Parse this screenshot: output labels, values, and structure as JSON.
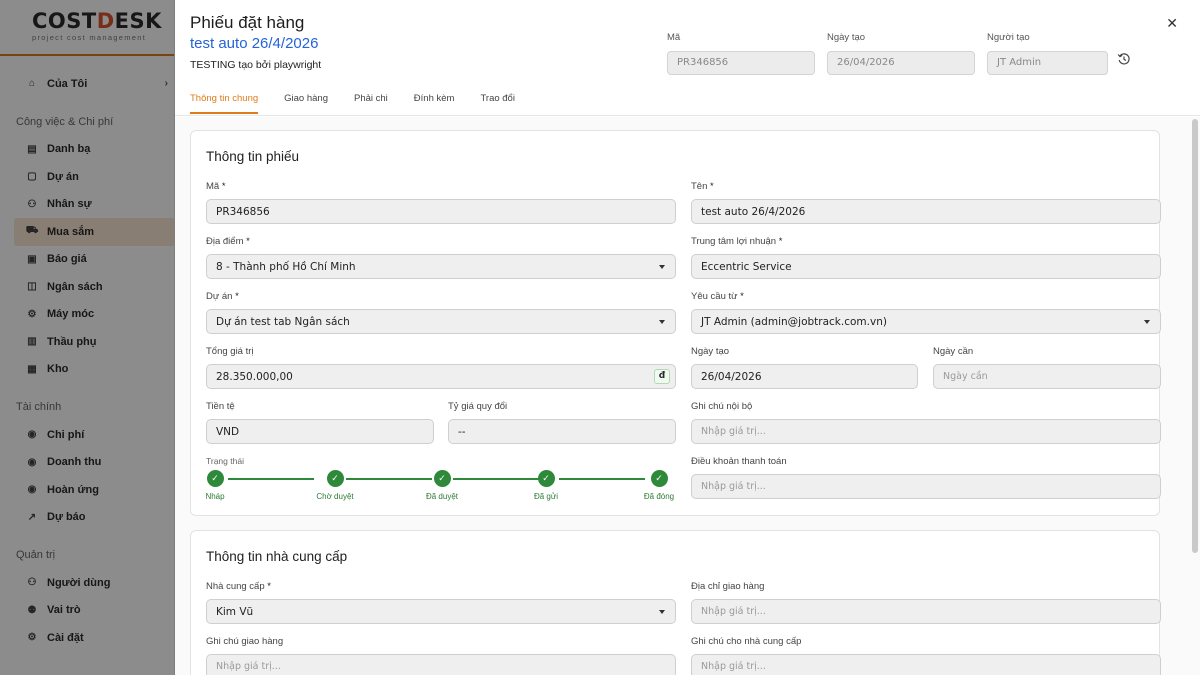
{
  "sidebar": {
    "brand_main": "COST",
    "brand_accent": "D",
    "brand_rest": "ESK",
    "tagline": "project cost management",
    "my_item": "Của Tôi",
    "group_work": "Công việc & Chi phí",
    "work_items": [
      "Danh bạ",
      "Dự án",
      "Nhân sự",
      "Mua sắm",
      "Báo giá",
      "Ngân sách",
      "Máy móc",
      "Thầu phụ",
      "Kho"
    ],
    "group_finance": "Tài chính",
    "finance_items": [
      "Chi phí",
      "Doanh thu",
      "Hoàn ứng",
      "Dự báo"
    ],
    "group_admin": "Quản trị",
    "admin_items": [
      "Người dùng",
      "Vai trò",
      "Cài đặt"
    ]
  },
  "header": {
    "title": "Phiếu đặt hàng",
    "subtitle": "test auto 26/4/2026",
    "note": "TESTING tạo bởi playwright",
    "code_label": "Mã",
    "code_value": "PR346856",
    "created_label": "Ngày tạo",
    "created_value": "26/04/2026",
    "creator_label": "Người tạo",
    "creator_value": "JT Admin",
    "close": "✕"
  },
  "tabs": [
    "Thông tin chung",
    "Giao hàng",
    "Phải chi",
    "Đính kèm",
    "Trao đổi"
  ],
  "info": {
    "title": "Thông tin phiếu",
    "code_label": "Mã",
    "code_value": "PR346856",
    "name_label": "Tên",
    "name_value": "test auto 26/4/2026",
    "location_label": "Địa điểm",
    "location_value": "8 - Thành phố Hồ Chí Minh",
    "profit_label": "Trung tâm lợi nhuận",
    "profit_value": "Eccentric Service",
    "project_label": "Dự án",
    "project_value": "Dự án test tab Ngân sách",
    "requested_label": "Yêu cầu từ",
    "requested_value": "JT Admin (admin@jobtrack.com.vn)",
    "total_label": "Tổng giá trị",
    "total_value": "28.350.000,00",
    "currency_symbol": "đ",
    "created_label": "Ngày tạo",
    "created_value": "26/04/2026",
    "needed_label": "Ngày cần",
    "needed_placeholder": "Ngày cần",
    "currency_label": "Tiền tệ",
    "currency_value": "VND",
    "rate_label": "Tỷ giá quy đổi",
    "rate_value": "--",
    "internal_note_label": "Ghi chú nội bộ",
    "placeholder": "Nhập giá trị...",
    "status_label": "Trạng thái",
    "steps": [
      "Nháp",
      "Chờ duyệt",
      "Đã duyệt",
      "Đã gửi",
      "Đã đóng"
    ],
    "payment_terms_label": "Điều khoản thanh toán"
  },
  "supplier": {
    "title": "Thông tin nhà cung cấp",
    "supplier_label": "Nhà cung cấp",
    "supplier_value": "Kim Vũ",
    "address_label": "Địa chỉ giao hàng",
    "delivery_note_label": "Ghi chú giao hàng",
    "supplier_note_label": "Ghi chú cho nhà cung cấp",
    "placeholder": "Nhập giá trị..."
  },
  "required_mark": "*",
  "check": "✓"
}
